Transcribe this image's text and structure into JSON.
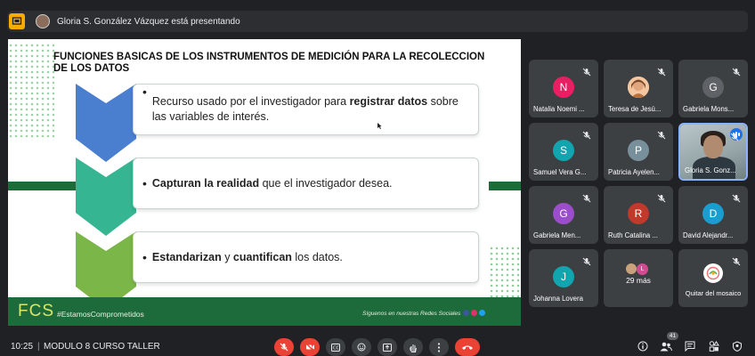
{
  "banner": {
    "presenter_text": "Gloria S. González Vázquez está presentando"
  },
  "slide": {
    "title": "FUNCIONES  BASICAS DE LOS INSTRUMENTOS DE MEDICIÓN PARA LA RECOLECCION DE LOS DATOS",
    "items": [
      {
        "pre": "Recurso usado por el investigador para ",
        "bold": "registrar datos",
        "post": " sobre las variables de interés."
      },
      {
        "pre": "",
        "bold": "Capturan la realidad",
        "post": " que el investigador desea."
      },
      {
        "pre": "",
        "bold": "Estandarizan",
        "mid": " y ",
        "bold2": "cuantifican",
        "post": " los datos."
      }
    ],
    "footer_logo": "FCS",
    "footer_tag": "#EstamosComprometidos",
    "footer_social": "Síguenos en nuestras Redes Sociales",
    "colors": {
      "chevron1": "#4a7fd0",
      "chevron2": "#35b592",
      "chevron3": "#7ab648",
      "footer": "#1d6a3a"
    }
  },
  "participants": [
    {
      "initial": "N",
      "name": "Natalia Noemi ...",
      "color": "#e91e63"
    },
    {
      "initial": "",
      "name": "Teresa de Jesú...",
      "color": "#f4b183"
    },
    {
      "initial": "G",
      "name": "Gabriela Mons...",
      "color": "#5f6368"
    },
    {
      "initial": "S",
      "name": "Samuel Vera G...",
      "color": "#12a4af"
    },
    {
      "initial": "P",
      "name": "Patricia Ayelen...",
      "color": "#78909c"
    },
    {
      "initial": "",
      "name": "Gloria S. Gonz...",
      "color": "#3c4043"
    },
    {
      "initial": "G",
      "name": "Gabriela Men...",
      "color": "#9c4dcc"
    },
    {
      "initial": "R",
      "name": "Ruth Catalina ...",
      "color": "#c0392b"
    },
    {
      "initial": "D",
      "name": "David Alejandr...",
      "color": "#1a9ed1"
    },
    {
      "initial": "J",
      "name": "Johanna Lovera",
      "color": "#12a4af"
    },
    {
      "initial": "L",
      "name": "29 más",
      "color": "#d14b91"
    },
    {
      "initial": "",
      "name": "Quitar del mosaico",
      "color": "#3c4043"
    }
  ],
  "bottom": {
    "time": "10:25",
    "separator": "|",
    "meeting_name": "MODULO 8 CURSO TALLER",
    "participants_count": "41"
  },
  "icons": {
    "presenting": "present-icon",
    "mic_off": "mic-off-icon",
    "cam_off": "camera-off-icon",
    "captions": "captions-icon",
    "emoji": "emoji-icon",
    "present": "present-screen-icon",
    "hand": "raise-hand-icon",
    "more": "more-options-icon",
    "hangup": "hang-up-icon",
    "info": "info-icon",
    "people": "people-icon",
    "chat": "chat-icon",
    "activities": "activities-icon",
    "host": "host-controls-icon"
  }
}
